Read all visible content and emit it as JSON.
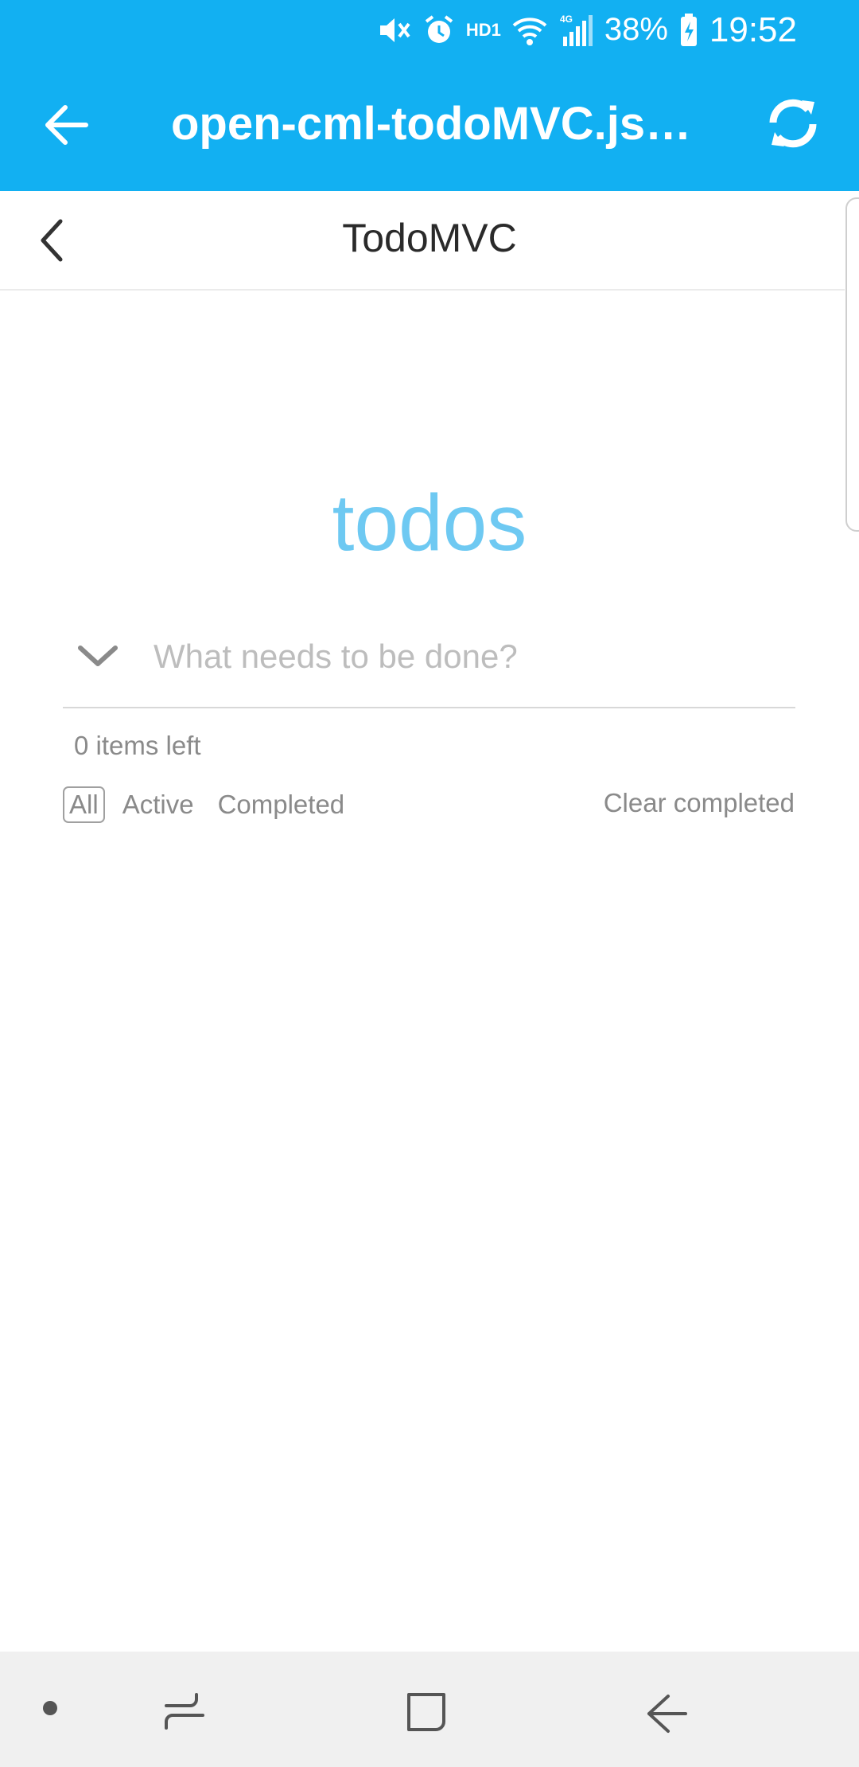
{
  "status_bar": {
    "icons": [
      "mute-icon",
      "alarm-icon",
      "hd-icon",
      "wifi-icon",
      "signal-4g-icon",
      "battery-charging-icon"
    ],
    "hd_label": "HD1",
    "net_label": "4G",
    "battery": "38%",
    "time": "19:52"
  },
  "app_bar": {
    "title": "open-cml-todoMVC.js?…",
    "back_icon": "arrow-left-icon",
    "refresh_icon": "refresh-icon",
    "color": "#12b0f2"
  },
  "page_header": {
    "title": "TodoMVC",
    "back_icon": "chevron-left-icon"
  },
  "todo_app": {
    "heading": "todos",
    "heading_color": "#6ec9f2",
    "new_todo_placeholder": "What needs to be done?",
    "new_todo_value": "",
    "items_left": "0 items left",
    "filters": [
      {
        "label": "All",
        "selected": true
      },
      {
        "label": "Active",
        "selected": false
      },
      {
        "label": "Completed",
        "selected": false
      }
    ],
    "clear_completed": "Clear completed"
  },
  "nav_bar": {
    "icons": [
      "dot-icon",
      "recent-apps-icon",
      "home-icon",
      "back-icon"
    ]
  }
}
